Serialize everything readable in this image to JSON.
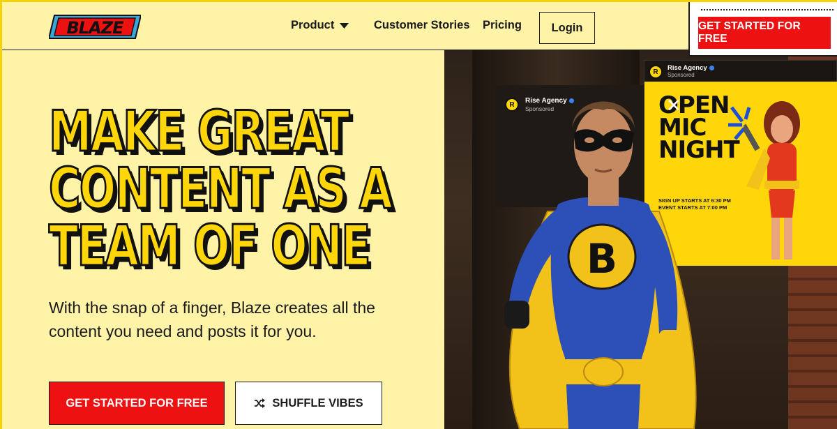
{
  "brand": {
    "logo_text": "BLAZE",
    "logo_color": "#ee1111",
    "accent": "#ffd60a",
    "background": "#fff3a8"
  },
  "nav": {
    "product": "Product",
    "customer_stories": "Customer Stories",
    "pricing": "Pricing",
    "login": "Login",
    "cta": "GET STARTED FOR FREE"
  },
  "hero": {
    "headline": [
      "MAKE GREAT",
      "CONTENT AS A",
      "TEAM OF ONE"
    ],
    "subheading": "With the snap of a finger, Blaze creates all the content you need and posts it for you.",
    "primary_cta": "GET STARTED FOR FREE",
    "secondary_cta": "SHUFFLE VIBES",
    "secondary_icon": "shuffle-icon"
  },
  "ad_card_back": {
    "account": "Rise Agency",
    "label": "Sponsored",
    "avatar_letter": "R"
  },
  "ad_card_front": {
    "account": "Rise Agency",
    "label": "Sponsored",
    "avatar_letter": "R",
    "poster_title": [
      "OPEN",
      "MIC",
      "NIGHT"
    ],
    "poster_details": [
      "SIGN UP STARTS AT 6:30 PM",
      "EVENT STARTS AT 7:00 PM"
    ]
  },
  "superhero": {
    "chest_letter": "B"
  }
}
